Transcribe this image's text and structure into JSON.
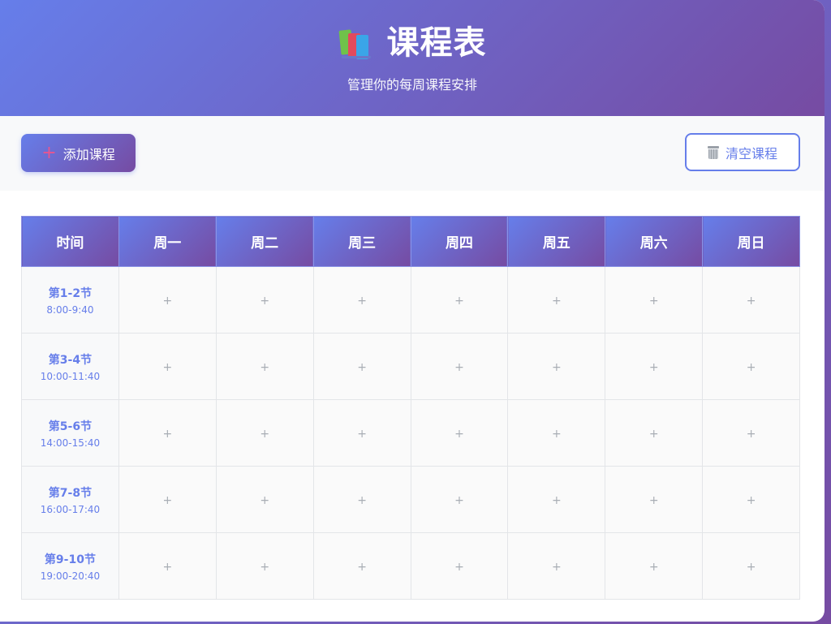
{
  "header": {
    "title": "课程表",
    "subtitle": "管理你的每周课程安排"
  },
  "toolbar": {
    "add_label": "添加课程",
    "clear_label": "清空课程"
  },
  "table": {
    "time_header": "时间",
    "days": [
      "周一",
      "周二",
      "周三",
      "周四",
      "周五",
      "周六",
      "周日"
    ],
    "slots": [
      {
        "label": "第1-2节",
        "time": "8:00-9:40"
      },
      {
        "label": "第3-4节",
        "time": "10:00-11:40"
      },
      {
        "label": "第5-6节",
        "time": "14:00-15:40"
      },
      {
        "label": "第7-8节",
        "time": "16:00-17:40"
      },
      {
        "label": "第9-10节",
        "time": "19:00-20:40"
      }
    ],
    "empty_cell_symbol": "+"
  },
  "colors": {
    "accent_start": "#667eea",
    "accent_end": "#764ba2"
  }
}
